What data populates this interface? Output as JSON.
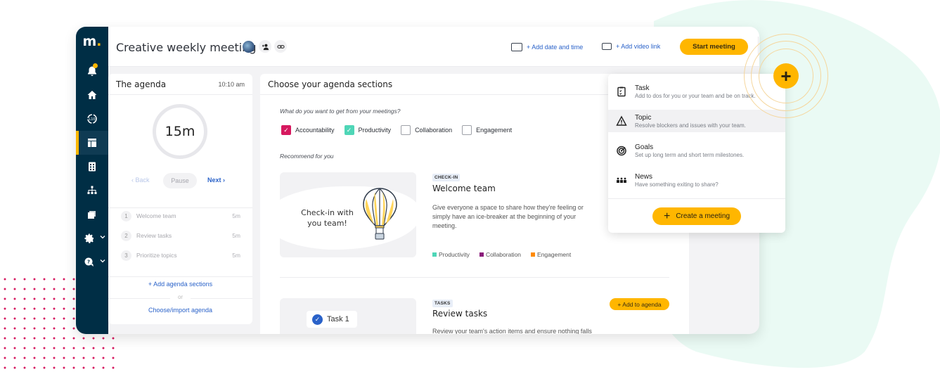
{
  "app": {
    "logo": "m",
    "title": "Creative weekly meeting",
    "colors": {
      "brand_navy": "#002e45",
      "accent_yellow": "#ffb600",
      "link_blue": "#2a62c9",
      "pink": "#d6195f",
      "mint": "#4fd6b7",
      "purple": "#8a1a7a",
      "orange": "#ff8a00"
    }
  },
  "sidebar": {
    "items": [
      {
        "icon": "bell-icon",
        "badge": true
      },
      {
        "icon": "home-icon"
      },
      {
        "icon": "l10-icon"
      },
      {
        "icon": "agenda-layout-icon",
        "active": true
      },
      {
        "icon": "calculator-icon"
      },
      {
        "icon": "org-chart-icon"
      },
      {
        "icon": "folders-icon"
      },
      {
        "icon": "settings-icon",
        "has_chevron": true
      },
      {
        "icon": "help-icon",
        "has_chevron": true
      }
    ]
  },
  "header": {
    "add_date_label": "+ Add date and time",
    "add_video_label": "+ Add video link",
    "start_meeting_label": "Start meeting",
    "more_label": "⋮"
  },
  "agenda": {
    "title": "The agenda",
    "time": "10:10 am",
    "timer": "15m",
    "back_label": "‹ Back",
    "pause_label": "Pause",
    "next_label": "Next ›",
    "items": [
      {
        "num": "1",
        "label": "Welcome team",
        "duration": "5m"
      },
      {
        "num": "2",
        "label": "Review tasks",
        "duration": "5m"
      },
      {
        "num": "3",
        "label": "Prioritize topics",
        "duration": "5m"
      }
    ],
    "add_sections_label": "+ Add agenda sections",
    "or_label": "or",
    "choose_import_label": "Choose/import agenda"
  },
  "main": {
    "title": "Choose your agenda sections",
    "question": "What do you want to get from your meetings?",
    "goals": [
      {
        "label": "Accountability",
        "checked": true,
        "color": "pink"
      },
      {
        "label": "Productivity",
        "checked": true,
        "color": "mint"
      },
      {
        "label": "Collaboration",
        "checked": false
      },
      {
        "label": "Engagement",
        "checked": false
      }
    ],
    "recommend_label": "Recommend for you",
    "cards": [
      {
        "image_caption": "Check-in with you team!",
        "tag": "CHECK-IN",
        "title": "Welcome team",
        "description": "Give everyone a space to share how they're feeling or simply have an ice-breaker at the beginning of your meeting.",
        "tags": [
          {
            "label": "Productivity",
            "color": "#4fd6b7"
          },
          {
            "label": "Collaboration",
            "color": "#8a1a7a"
          },
          {
            "label": "Engagement",
            "color": "#ff8a00"
          }
        ]
      },
      {
        "image_caption": "Task 1",
        "tag": "TASKS",
        "title": "Review tasks",
        "description": "Review your team's action items and ensure nothing falls",
        "add_label": "+ Add to agenda"
      }
    ]
  },
  "dropdown": {
    "items": [
      {
        "icon": "clipboard-check-icon",
        "title": "Task",
        "subtitle": "Add to dos for you or your team and be on track."
      },
      {
        "icon": "warning-triangle-icon",
        "title": "Topic",
        "subtitle": "Resolve blockers and issues with your team.",
        "hovered": true
      },
      {
        "icon": "target-icon",
        "title": "Goals",
        "subtitle": "Set up long term and short term milestones."
      },
      {
        "icon": "people-group-icon",
        "title": "News",
        "subtitle": "Have something exiting to share?"
      }
    ],
    "create_label": "Create a meeting",
    "create_plus": "+"
  },
  "fab": {
    "label": "+"
  }
}
